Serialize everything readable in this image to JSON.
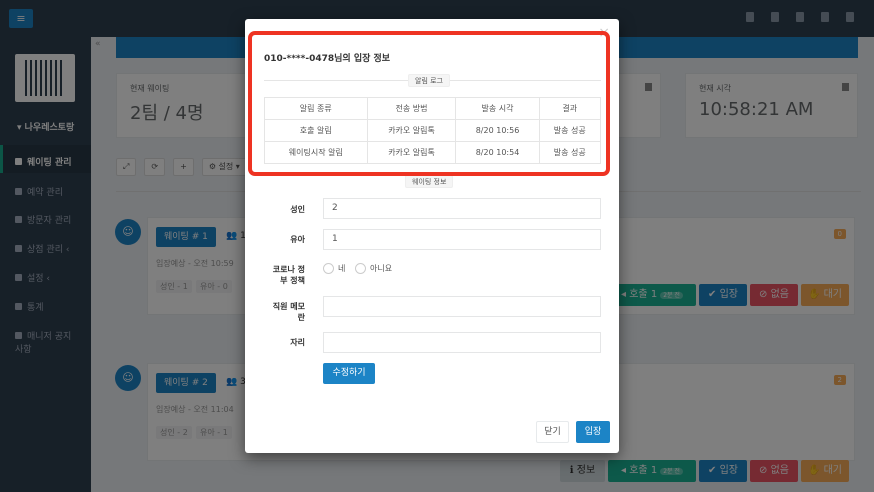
{
  "sidebar": {
    "store_name": "나우레스토랑",
    "items": [
      {
        "label": "웨이팅 관리",
        "active": true
      },
      {
        "label": "예약 관리"
      },
      {
        "label": "방문자 관리"
      },
      {
        "label": "상점 관리"
      },
      {
        "label": "설정"
      },
      {
        "label": "통계"
      },
      {
        "label": "매니저 공지"
      },
      {
        "label": "사항"
      }
    ]
  },
  "stats": {
    "waiting_label": "현재 웨이팅",
    "waiting_value": "2팀 / 4명",
    "time_label": "현재 시각",
    "time_value": "10:58:21 AM"
  },
  "toolbar": {
    "settings_label": "설정"
  },
  "waitings": [
    {
      "team": "웨이팅 # 1",
      "count": "1",
      "eta": "입장예상 - 오전 10:59",
      "adult": "성인 - 1",
      "child": "유아 - 0",
      "badge": "0",
      "call_label": "호출 1",
      "call_pill": "2분 전",
      "enter_label": "입장",
      "none_label": "없음",
      "wait_label": "대기"
    },
    {
      "team": "웨이팅 # 2",
      "count": "3",
      "eta": "입장예상 - 오전 11:04",
      "adult": "성인 - 2",
      "child": "유아 - 1",
      "badge": "2",
      "info_label": "정보",
      "call_label": "호출 1",
      "call_pill": "2분 전",
      "enter_label": "입장",
      "none_label": "없음",
      "wait_label": "대기"
    }
  ],
  "modal": {
    "close": "×",
    "title": "010-****-0478님의 입장 정보",
    "log_section": "알림 로그",
    "log_headers": [
      "알림 종류",
      "전송 방법",
      "발송 시각",
      "결과"
    ],
    "log_rows": [
      [
        "호출 알림",
        "카카오 알림톡",
        "8/20 10:56",
        "발송 성공"
      ],
      [
        "웨이팅시작 알림",
        "카카오 알림톡",
        "8/20 10:54",
        "발송 성공"
      ]
    ],
    "info_section": "웨이팅 정보",
    "fields": {
      "adult_label": "성인",
      "adult_value": "2",
      "child_label": "유아",
      "child_value": "1",
      "covid_label_1": "코로나 정",
      "covid_label_2": "부 정책",
      "yes": "네",
      "no": "아니요",
      "memo_label_1": "직원 메모",
      "memo_label_2": "란",
      "memo_value": "",
      "seat_label": "자리",
      "seat_value": ""
    },
    "edit_button": "수정하기",
    "close_button": "닫기",
    "enter_button": "입장"
  }
}
